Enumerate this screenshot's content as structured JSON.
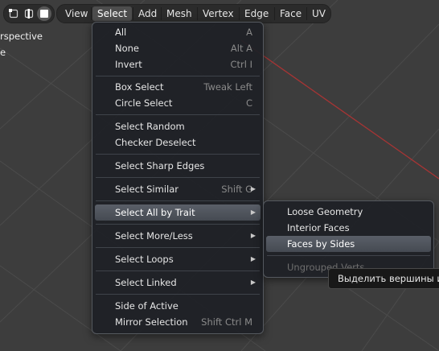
{
  "viewport": {
    "view_label": "rspective",
    "sub_label": "e"
  },
  "select_modes": {
    "icons": [
      "vertex-select-icon",
      "edge-select-icon",
      "face-select-icon"
    ],
    "active": "face-select-icon"
  },
  "menubar": {
    "items": [
      "View",
      "Select",
      "Add",
      "Mesh",
      "Vertex",
      "Edge",
      "Face",
      "UV"
    ],
    "active": "Select"
  },
  "select_menu": {
    "groups": [
      [
        {
          "label": "All",
          "key": "A"
        },
        {
          "label": "None",
          "key": "Alt A"
        },
        {
          "label": "Invert",
          "key": "Ctrl I"
        }
      ],
      [
        {
          "label": "Box Select",
          "key": "Tweak Left"
        },
        {
          "label": "Circle Select",
          "key": "C"
        }
      ],
      [
        {
          "label": "Select Random",
          "key": ""
        },
        {
          "label": "Checker Deselect",
          "key": ""
        }
      ],
      [
        {
          "label": "Select Sharp Edges",
          "key": ""
        }
      ],
      [
        {
          "label": "Select Similar",
          "key": "Shift G"
        }
      ],
      [
        {
          "label": "Select All by Trait",
          "key": "",
          "submenu": true,
          "highlighted": true
        }
      ],
      [
        {
          "label": "Select More/Less",
          "key": "",
          "submenu": true
        }
      ],
      [
        {
          "label": "Select Loops",
          "key": "",
          "submenu": true
        }
      ],
      [
        {
          "label": "Select Linked",
          "key": "",
          "submenu": true
        }
      ],
      [
        {
          "label": "Side of Active",
          "key": ""
        },
        {
          "label": "Mirror Selection",
          "key": "Shift Ctrl M"
        }
      ]
    ]
  },
  "trait_submenu": {
    "items": [
      {
        "label": "Loose Geometry"
      },
      {
        "label": "Interior Faces"
      },
      {
        "label": "Faces by Sides",
        "highlighted": true
      },
      {
        "label": "Ungrouped Verts",
        "disabled": true
      }
    ]
  },
  "tooltip": {
    "text": "Выделить вершины и"
  },
  "colors": {
    "viewport_bg": "#3d3d3d",
    "grid": "#4a4a4a",
    "x_axis": "#b43a3a",
    "menu_bg": "#1f2126",
    "highlight": "#50555d"
  }
}
